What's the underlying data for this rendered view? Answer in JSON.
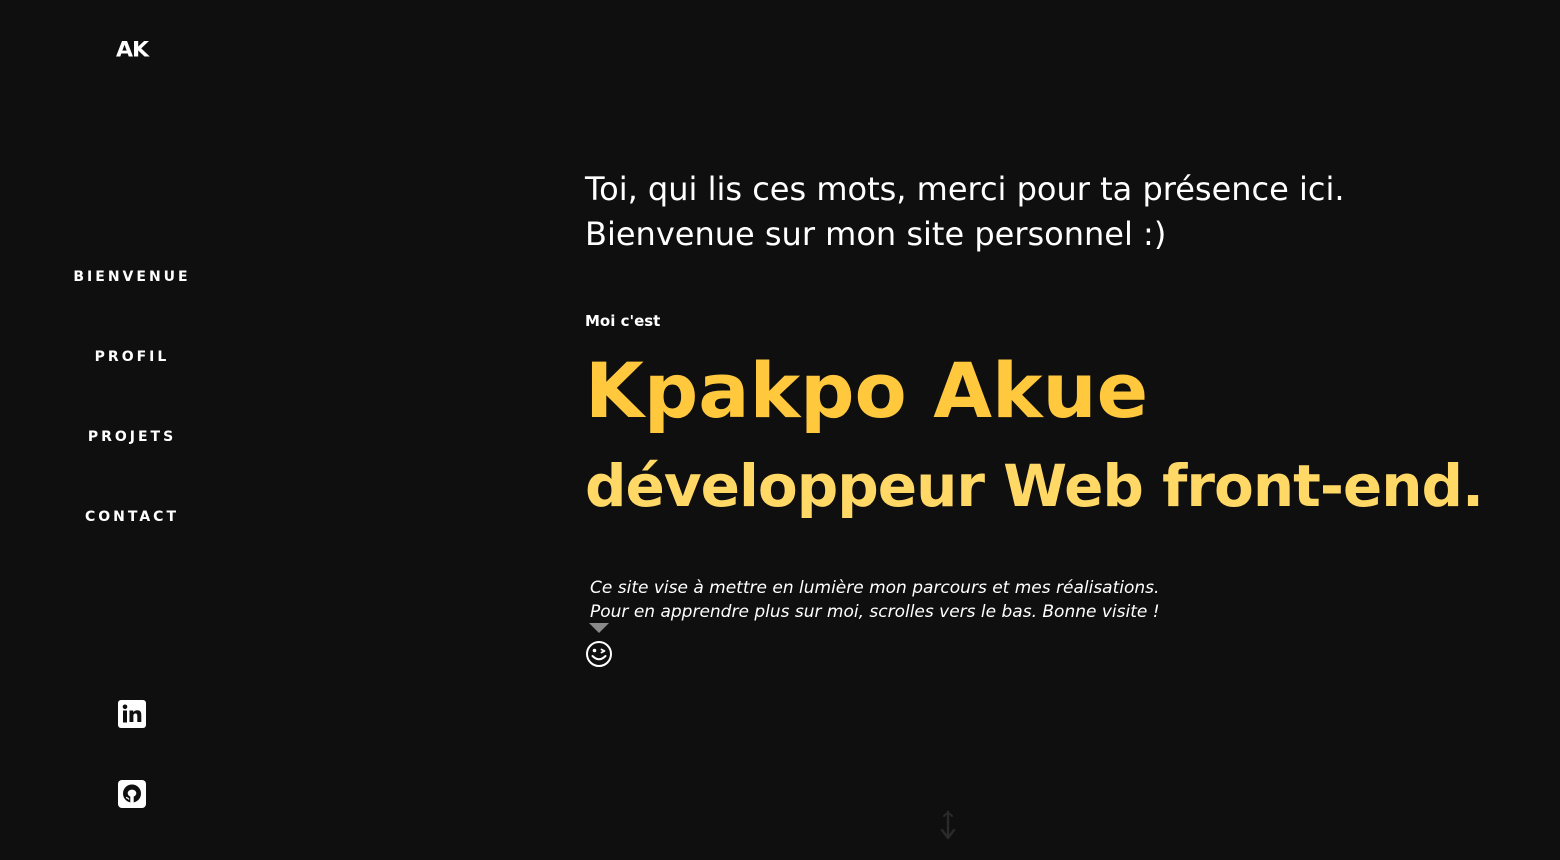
{
  "sidebar": {
    "logo": "AK",
    "nav": [
      {
        "label": "BIENVENUE"
      },
      {
        "label": "PROFIL"
      },
      {
        "label": "PROJETS"
      },
      {
        "label": "CONTACT"
      }
    ],
    "social": [
      {
        "icon": "linkedin-icon"
      },
      {
        "icon": "github-icon"
      }
    ]
  },
  "hero": {
    "greeting_line1": "Toi, qui lis ces mots, merci pour ta présence ici.",
    "greeting_line2": "Bienvenue sur mon site personnel :)",
    "intro_label": "Moi c'est",
    "name": "Kpakpo Akue",
    "role": "développeur Web front-end.",
    "description_line1": "Ce site vise à mettre en lumière mon parcours et mes réalisations.",
    "description_line2": "Pour en apprendre plus sur moi, scrolles vers le bas. Bonne visite !",
    "wink_icon": "wink-face-icon",
    "scroll_icon": "scroll-down-icon"
  },
  "colors": {
    "background": "#0f0f0f",
    "name": "#ffc83d",
    "role": "#ffd866",
    "text": "#ffffff"
  }
}
